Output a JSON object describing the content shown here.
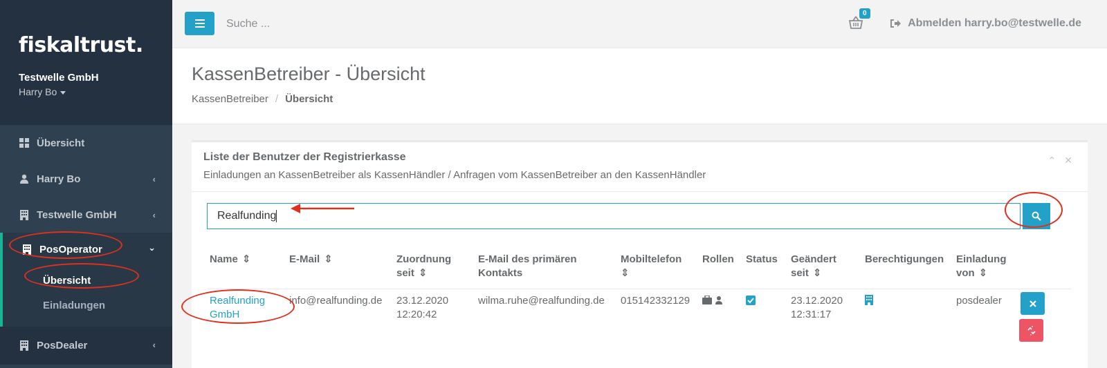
{
  "sidebar": {
    "logo": "fiskaltrust.",
    "company": "Testwelle GmbH",
    "user": "Harry Bo",
    "items": [
      {
        "label": "Übersicht"
      },
      {
        "label": "Harry Bo"
      },
      {
        "label": "Testwelle GmbH"
      },
      {
        "label": "PosOperator"
      },
      {
        "label": "PosDealer"
      }
    ],
    "sub_items": [
      {
        "label": "Übersicht"
      },
      {
        "label": "Einladungen"
      }
    ]
  },
  "topbar": {
    "search_placeholder": "Suche ...",
    "cart_count": "0",
    "logout_label": "Abmelden harry.bo@testwelle.de"
  },
  "page": {
    "title": "KassenBetreiber - Übersicht",
    "breadcrumb": [
      "KassenBetreiber",
      "Übersicht"
    ]
  },
  "panel": {
    "title": "Liste der Benutzer der Registrierkasse",
    "subtitle": "Einladungen an KassenBetreiber als KassenHändler / Anfragen vom KassenBetreiber an den KassenHändler",
    "search_value": "Realfunding"
  },
  "table": {
    "headers": [
      {
        "l1": "Name",
        "l2": ""
      },
      {
        "l1": "E-Mail",
        "l2": ""
      },
      {
        "l1": "Zuordnung",
        "l2": "seit"
      },
      {
        "l1": "E-Mail des primären",
        "l2": "Kontakts"
      },
      {
        "l1": "Mobiltelefon",
        "l2": ""
      },
      {
        "l1": "Rollen",
        "l2": ""
      },
      {
        "l1": "Status",
        "l2": ""
      },
      {
        "l1": "Geändert",
        "l2": "seit"
      },
      {
        "l1": "Berechtigungen",
        "l2": ""
      },
      {
        "l1": "Einladung",
        "l2": "von"
      }
    ],
    "rows": [
      {
        "name_l1": "Realfunding",
        "name_l2": "GmbH",
        "email": "info@realfunding.de",
        "since_date": "23.12.2020",
        "since_time": "12:20:42",
        "primary_email": "wilma.ruhe@realfunding.de",
        "mobile": "015142332129",
        "changed_date": "23.12.2020",
        "changed_time": "12:31:17",
        "invited_by": "posdealer",
        "status_checked": true
      }
    ]
  },
  "colors": {
    "accent": "#23a1c9",
    "sidebar_bg": "#2f4050",
    "active_border": "#1ab394",
    "danger": "#ed5565",
    "annotation": "#e0301e"
  }
}
